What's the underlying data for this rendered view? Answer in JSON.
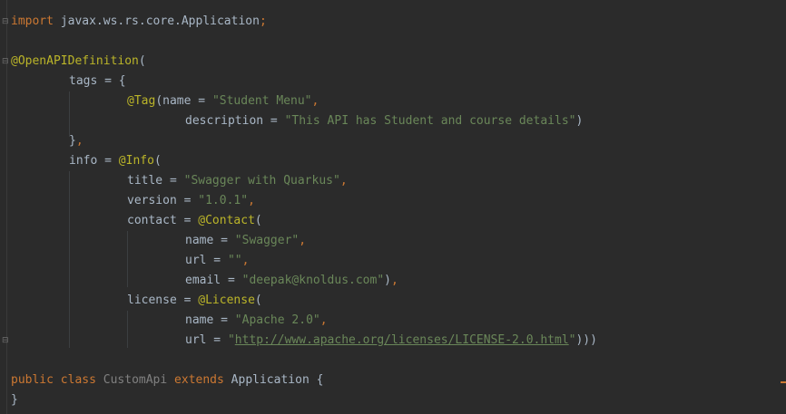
{
  "code": {
    "import_kw": "import",
    "import_path": " javax.ws.rs.core.Application",
    "import_semicolon": ";",
    "openapi_ann": "@OpenAPIDefinition",
    "openapi_paren": "(",
    "tags_key": "tags = {",
    "tag_ann": "@Tag",
    "tag_name_key": "(name = ",
    "tag_name_val": "\"Student Menu\"",
    "comma": ",",
    "desc_key": "description = ",
    "desc_val": "\"This API has Student and course details\"",
    "close_paren": ")",
    "tags_close": "}",
    "info_key": "info = ",
    "info_ann": "@Info",
    "open_paren": "(",
    "title_key": "title = ",
    "title_val": "\"Swagger with Quarkus\"",
    "version_key": "version = ",
    "version_val": "\"1.0.1\"",
    "contact_key": "contact = ",
    "contact_ann": "@Contact",
    "name_key": "name = ",
    "contact_name_val": "\"Swagger\"",
    "url_key": "url = ",
    "contact_url_val": "\"\"",
    "email_key": "email = ",
    "email_val": "\"deepak@knoldus.com\"",
    "license_key": "license = ",
    "license_ann": "@License",
    "license_name_val": "\"Apache 2.0\"",
    "quote": "\"",
    "license_url": "http://www.apache.org/licenses/LICENSE-2.0.html",
    "license_close": ")))",
    "public_kw": "public",
    "class_kw": " class ",
    "class_name": "CustomApi",
    "extends_kw": " extends ",
    "super_class": "Application",
    "brace_open": " {",
    "brace_close": "}"
  }
}
